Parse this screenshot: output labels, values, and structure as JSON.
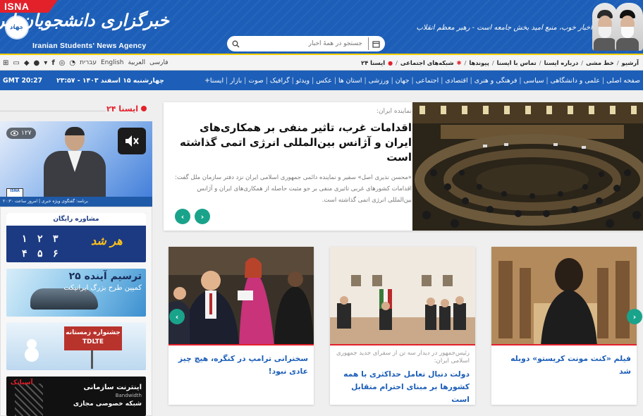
{
  "header": {
    "badge": "ISNA",
    "logo_text": "جهاد",
    "brand_fa": "خبرگزاری دانشجویان ایران ، ایسنا",
    "brand_en": "Iranian Students' News Agency",
    "search_placeholder": "جستجو در همهٔ اخبار",
    "slogan": "اخبار خوب، منبع امید بخش جامعه است - رهبر معظم انقلاب"
  },
  "topnav": {
    "items": [
      "آرشیو",
      "خط مشی",
      "درباره ایسنا",
      "تماس با ایسنا",
      "پیوندها",
      "شبکه‌های اجتماعی",
      "ایسنا ۲۴"
    ],
    "languages": [
      "فارسی",
      "العربية",
      "English",
      "עברית"
    ],
    "icons": [
      "rss-icon",
      "instagram-icon",
      "facebook-icon",
      "twitter-icon",
      "apple-icon",
      "android-icon",
      "desktop-icon",
      "windows-icon"
    ]
  },
  "mainnav": {
    "items": [
      "صفحه اصلی",
      "علمی و دانشگاهی",
      "سیاسی",
      "فرهنگی و هنری",
      "اقتصادی",
      "اجتماعی",
      "جهان",
      "ورزشی",
      "استان ها",
      "عکس",
      "ویدئو",
      "گرافیک",
      "صوت",
      "بازار",
      "ایسنا+"
    ],
    "date": "چهارشنبه ۱۵ اسفند ۱۴۰۳ - ۲۳:۵۷",
    "time": "GMT 20:27"
  },
  "ticker": {
    "title": "ایسنا ۲۴"
  },
  "video": {
    "views": "۱۲۷",
    "band_text": "برنامه: گفتگوی ویژه خبری | امروز ساعت ۲۰:۳۰",
    "logo": "ISNA"
  },
  "ads": {
    "ad1_top": "مشاوره رایگان",
    "ad1_nums": [
      "۱",
      "۲",
      "۳",
      "۴",
      "۵",
      "۶"
    ],
    "ad1_text": "هر شد",
    "ad2_title": "ترسیم آینده ۲۵",
    "ad2_sub": "کمپین طرح بزرگ ایرانیکت",
    "ad3_title": "جشنواره زمستانه",
    "ad3_sub": "TDLTE",
    "ad4_title": "اینترنت سازمانی",
    "ad4_sub": "Bandwidth",
    "ad4_title2": "شبکه خصوصی مجازی",
    "ad4_brand": "آسیاتک"
  },
  "feature": {
    "kicker": "نماینده ایران:",
    "title": "اقدامات غرب، تاثیر منفی بر همکاری‌های ایران و آژانس بین‌المللی انرژی اتمی گذاشته است",
    "lead": "«محسن نذیری اصل» سفیر و نماینده دائمی جمهوری اسلامی ایران نزد دفتر سازمان ملل گفت: اقدامات کشورهای غربی تاثیری منفی بر جو مثبت حاصله از همکاری‌های ایران و آژانس بین‌المللی انرژی اتمی گذاشته است."
  },
  "cards": [
    {
      "kicker": "",
      "title": "فیلم «کنت مونت کریستو» دوبله شد"
    },
    {
      "kicker": "رئیس‌جمهور در دیدار سه تن از سفرای جدید جمهوری اسلامی ایران:",
      "title": "دولت دنبال تعامل حداکثری با همه کشورها بر مبنای احترام متقابل است"
    },
    {
      "kicker": "",
      "title": "سخنرانی ترامپ در کنگره، هیچ چیز عادی نبود!"
    }
  ],
  "colors": {
    "brand_blue": "#1d5fb8",
    "accent_red": "#e3212b",
    "accent_green": "#1aa38b",
    "highlight_yellow": "#ffd200"
  }
}
